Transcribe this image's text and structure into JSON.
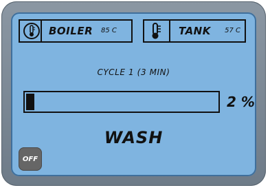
{
  "boiler": {
    "label": "BOILER",
    "value": "85 C"
  },
  "tank": {
    "label": "TANK",
    "value": "57 C"
  },
  "cycle_text": "CYCLE 1 (3 MIN)",
  "progress": {
    "fraction": 0.02,
    "text": "2 %"
  },
  "mode_text": "WASH",
  "off_button_label": "OFF",
  "icons": [
    "thermometer-icon",
    "thermometer-icon"
  ],
  "colors": {
    "screen": "#7fb4e0",
    "frame": "#7a8794",
    "ink": "#111111",
    "button": "#666666"
  }
}
